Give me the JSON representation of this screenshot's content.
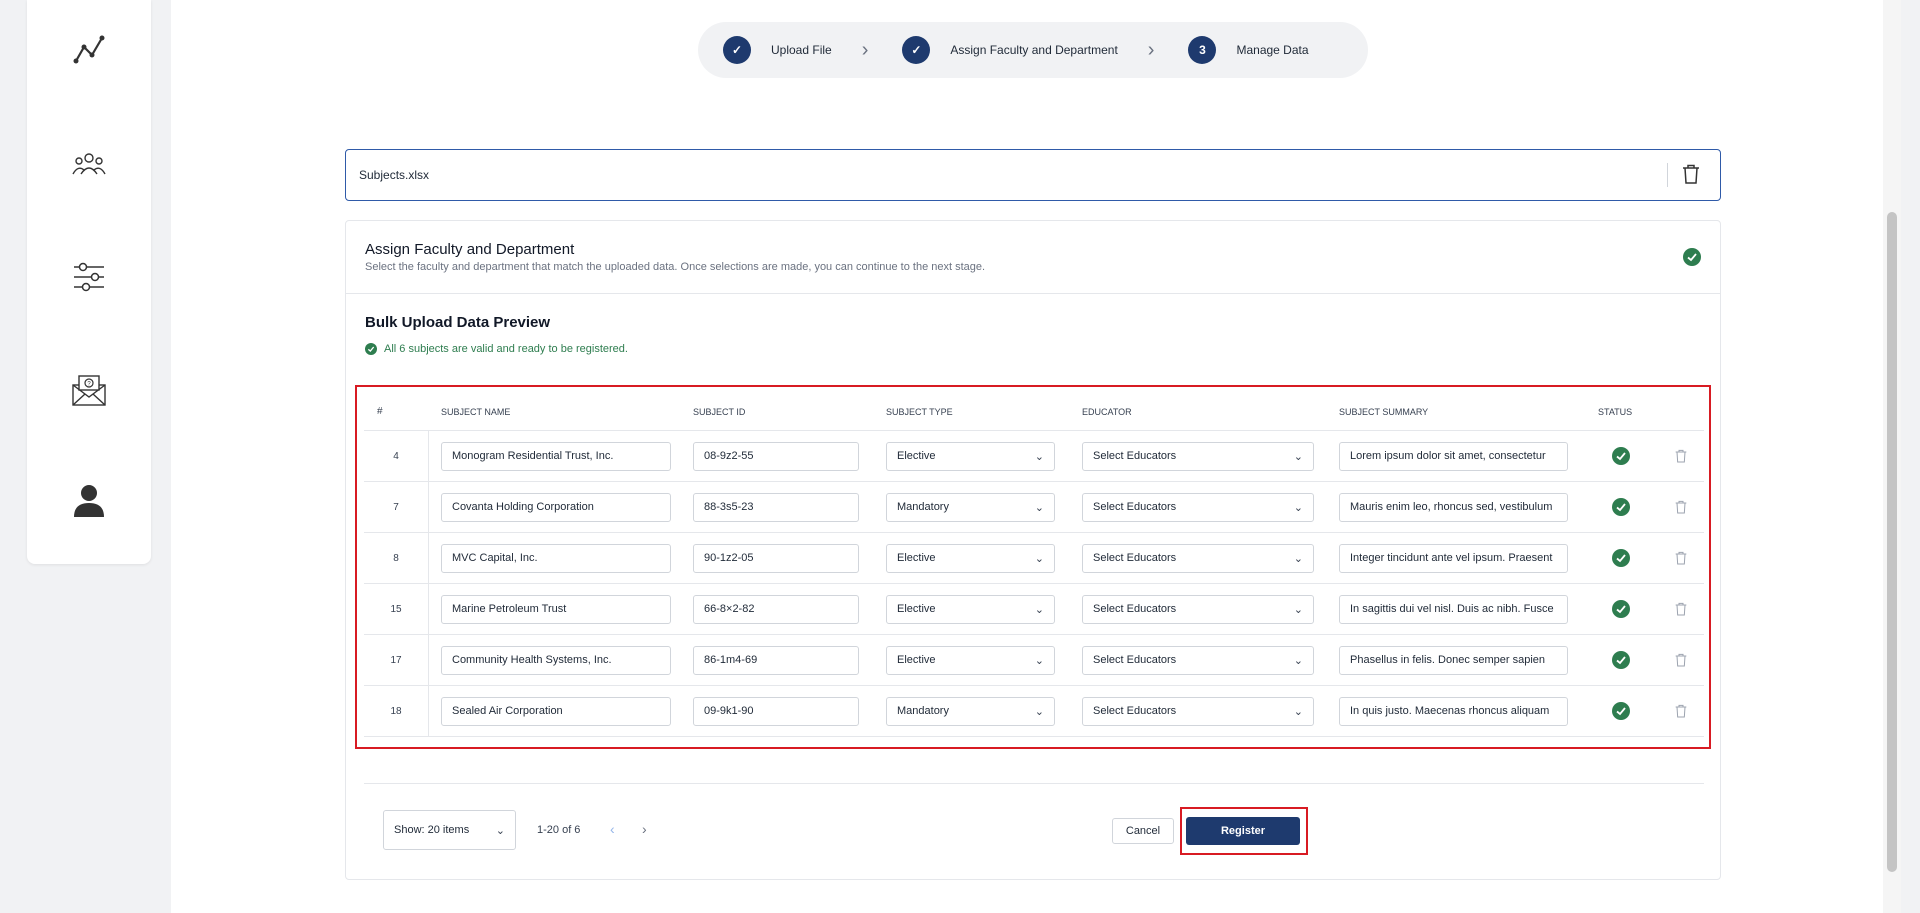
{
  "sidebar": {
    "icons": [
      "analytics-icon",
      "people-icon",
      "sliders-icon",
      "mail-help-icon",
      "user-icon"
    ]
  },
  "stepper": {
    "steps": [
      {
        "label": "Upload File",
        "marker": "✓"
      },
      {
        "label": "Assign Faculty and Department",
        "marker": "✓"
      },
      {
        "label": "Manage Data",
        "marker": "3"
      }
    ]
  },
  "file": {
    "name": "Subjects.xlsx"
  },
  "assign": {
    "title": "Assign Faculty and Department",
    "subtitle": "Select the faculty and department that match the uploaded data. Once selections are made, you can continue to the next stage."
  },
  "preview": {
    "title": "Bulk Upload Data Preview",
    "valid_message": "All 6 subjects are valid and ready to be registered."
  },
  "table": {
    "headers": [
      "#",
      "SUBJECT NAME",
      "SUBJECT ID",
      "SUBJECT TYPE",
      "EDUCATOR",
      "SUBJECT SUMMARY",
      "STATUS"
    ],
    "rows": [
      {
        "num": "4",
        "name": "Monogram Residential Trust, Inc.",
        "id": "08-9z2-55",
        "type": "Elective",
        "educator": "Select Educators",
        "summary": "Lorem ipsum dolor sit amet, consectetur"
      },
      {
        "num": "7",
        "name": "Covanta Holding Corporation",
        "id": "88-3s5-23",
        "type": "Mandatory",
        "educator": "Select Educators",
        "summary": "Mauris enim leo, rhoncus sed, vestibulum"
      },
      {
        "num": "8",
        "name": "MVC Capital, Inc.",
        "id": "90-1z2-05",
        "type": "Elective",
        "educator": "Select Educators",
        "summary": "Integer tincidunt ante vel ipsum. Praesent"
      },
      {
        "num": "15",
        "name": "Marine Petroleum Trust",
        "id": "66-8×2-82",
        "type": "Elective",
        "educator": "Select Educators",
        "summary": "In sagittis dui vel nisl. Duis ac nibh. Fusce"
      },
      {
        "num": "17",
        "name": "Community Health Systems, Inc.",
        "id": "86-1m4-69",
        "type": "Elective",
        "educator": "Select Educators",
        "summary": "Phasellus in felis. Donec semper sapien"
      },
      {
        "num": "18",
        "name": "Sealed Air Corporation",
        "id": "09-9k1-90",
        "type": "Mandatory",
        "educator": "Select Educators",
        "summary": "In quis justo. Maecenas rhoncus aliquam"
      }
    ]
  },
  "footer": {
    "show_label": "Show: 20 items",
    "range": "1-20 of 6",
    "cancel": "Cancel",
    "register": "Register"
  },
  "colors": {
    "primary": "#1e3a6e",
    "success": "#2e7d4f",
    "highlight": "#d81b23"
  }
}
